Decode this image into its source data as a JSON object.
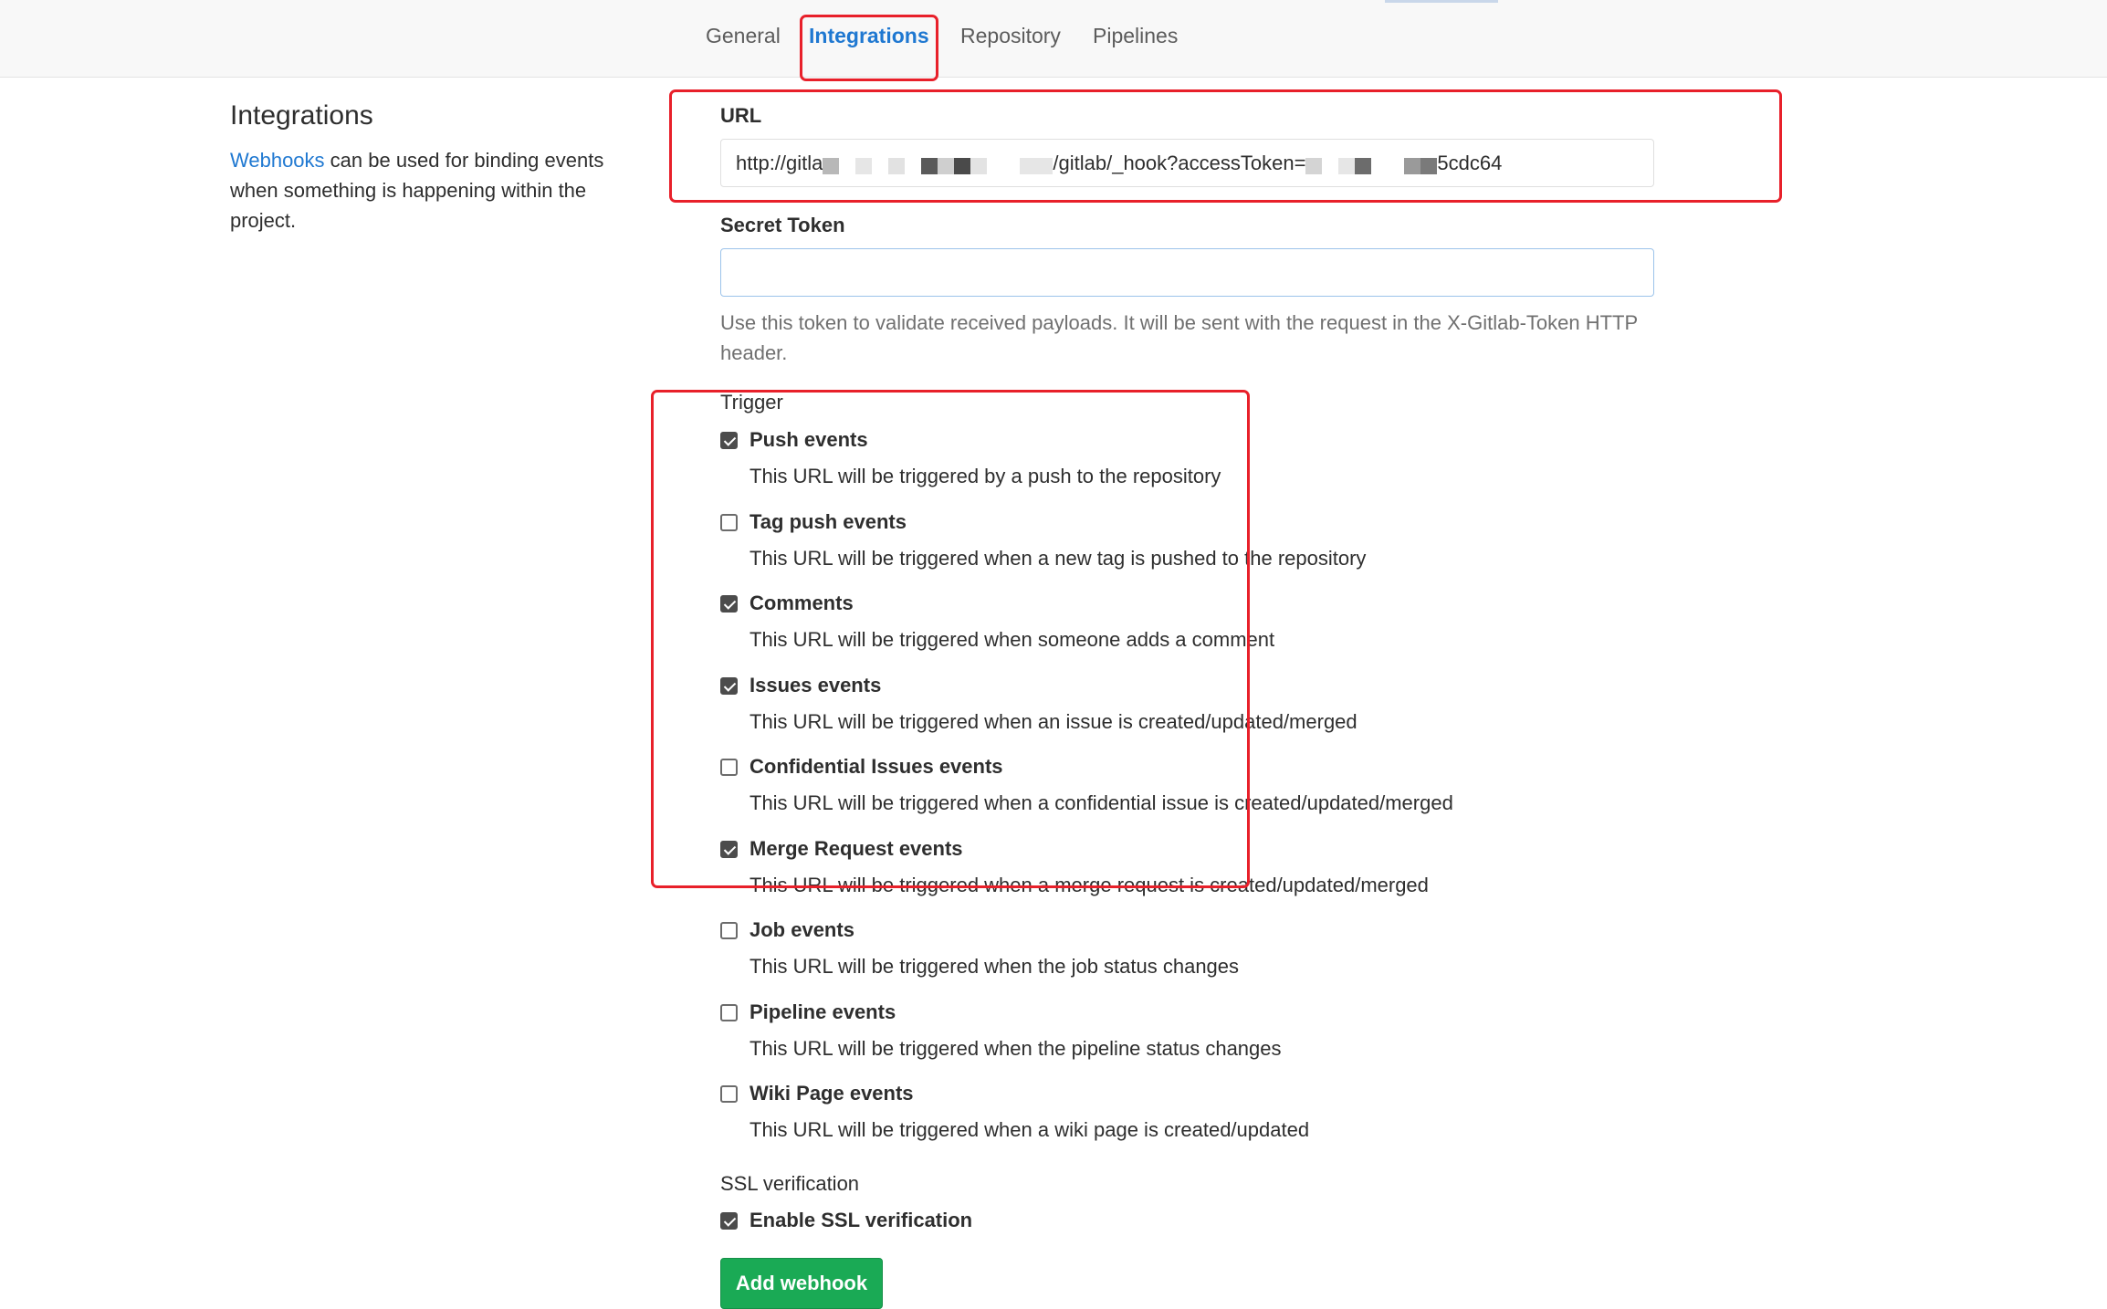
{
  "tabs": [
    {
      "label": "General",
      "active": false
    },
    {
      "label": "Integrations",
      "active": true
    },
    {
      "label": "Repository",
      "active": false
    },
    {
      "label": "Pipelines",
      "active": false
    }
  ],
  "sidebar": {
    "title": "Integrations",
    "link_text": "Webhooks",
    "description": " can be used for binding events when something is happening within the project."
  },
  "url_field": {
    "label": "URL",
    "value_start": "http://gitla",
    "value_middle": "/gitlab/_hook?accessToken=",
    "value_end": "5cdc64"
  },
  "secret_token": {
    "label": "Secret Token",
    "value": "",
    "help": "Use this token to validate received payloads. It will be sent with the request in the X-Gitlab-Token HTTP header."
  },
  "trigger": {
    "label": "Trigger",
    "items": [
      {
        "label": "Push events",
        "checked": true,
        "desc": "This URL will be triggered by a push to the repository"
      },
      {
        "label": "Tag push events",
        "checked": false,
        "desc": "This URL will be triggered when a new tag is pushed to the repository"
      },
      {
        "label": "Comments",
        "checked": true,
        "desc": "This URL will be triggered when someone adds a comment"
      },
      {
        "label": "Issues events",
        "checked": true,
        "desc": "This URL will be triggered when an issue is created/updated/merged"
      },
      {
        "label": "Confidential Issues events",
        "checked": false,
        "desc": "This URL will be triggered when a confidential issue is created/updated/merged"
      },
      {
        "label": "Merge Request events",
        "checked": true,
        "desc": "This URL will be triggered when a merge request is created/updated/merged"
      },
      {
        "label": "Job events",
        "checked": false,
        "desc": "This URL will be triggered when the job status changes"
      },
      {
        "label": "Pipeline events",
        "checked": false,
        "desc": "This URL will be triggered when the pipeline status changes"
      },
      {
        "label": "Wiki Page events",
        "checked": false,
        "desc": "This URL will be triggered when a wiki page is created/updated"
      }
    ]
  },
  "ssl": {
    "label": "SSL verification",
    "checkbox_label": "Enable SSL verification",
    "checked": true
  },
  "submit_label": "Add webhook",
  "colors": {
    "link": "#1f78d1",
    "annotation": "#e8202a",
    "button": "#1aaa55"
  }
}
